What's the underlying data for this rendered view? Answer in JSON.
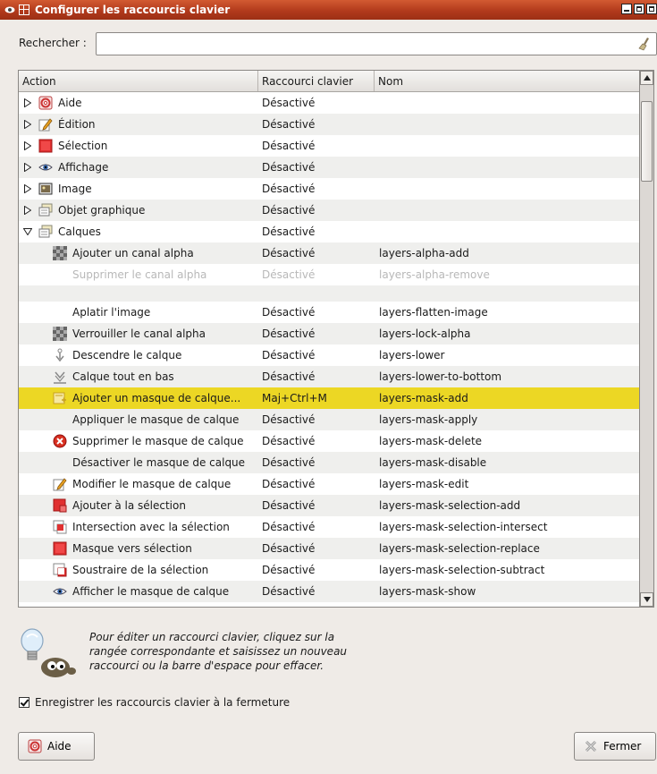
{
  "window": {
    "title": "Configurer les raccourcis clavier"
  },
  "search": {
    "label": "Rechercher :",
    "value": "",
    "placeholder": ""
  },
  "table": {
    "headers": [
      "Action",
      "Raccourci clavier",
      "Nom"
    ],
    "rows": [
      {
        "action": "Aide",
        "shortcut": "Désactivé",
        "name": "",
        "level": 0,
        "expander": "collapsed",
        "icon": "help-icon"
      },
      {
        "action": "Édition",
        "shortcut": "Désactivé",
        "name": "",
        "level": 0,
        "expander": "collapsed",
        "icon": "edit-icon"
      },
      {
        "action": "Sélection",
        "shortcut": "Désactivé",
        "name": "",
        "level": 0,
        "expander": "collapsed",
        "icon": "selection-icon"
      },
      {
        "action": "Affichage",
        "shortcut": "Désactivé",
        "name": "",
        "level": 0,
        "expander": "collapsed",
        "icon": "eye-icon"
      },
      {
        "action": "Image",
        "shortcut": "Désactivé",
        "name": "",
        "level": 0,
        "expander": "collapsed",
        "icon": "image-icon"
      },
      {
        "action": "Objet graphique",
        "shortcut": "Désactivé",
        "name": "",
        "level": 0,
        "expander": "collapsed",
        "icon": "drawable-icon"
      },
      {
        "action": "Calques",
        "shortcut": "Désactivé",
        "name": "",
        "level": 0,
        "expander": "expanded",
        "icon": "layers-icon"
      },
      {
        "action": "Ajouter un canal alpha",
        "shortcut": "Désactivé",
        "name": "layers-alpha-add",
        "level": 1,
        "icon": "alpha-icon"
      },
      {
        "action": "Supprimer le canal alpha",
        "shortcut": "Désactivé",
        "name": "layers-alpha-remove",
        "level": 1,
        "icon": "",
        "faded": true
      },
      {
        "action": "Aplatir l'image",
        "shortcut": "Désactivé",
        "name": "layers-flatten-image",
        "level": 1,
        "icon": ""
      },
      {
        "action": "Verrouiller le canal alpha",
        "shortcut": "Désactivé",
        "name": "layers-lock-alpha",
        "level": 1,
        "icon": "alpha-icon"
      },
      {
        "action": "Descendre le calque",
        "shortcut": "Désactivé",
        "name": "layers-lower",
        "level": 1,
        "icon": "lower-icon"
      },
      {
        "action": "Calque tout en bas",
        "shortcut": "Désactivé",
        "name": "layers-lower-to-bottom",
        "level": 1,
        "icon": "lower-bottom-icon"
      },
      {
        "action": "Ajouter un masque de calque...",
        "shortcut": "Maj+Ctrl+M",
        "name": "layers-mask-add",
        "level": 1,
        "icon": "mask-add-icon",
        "selected": true
      },
      {
        "action": "Appliquer le masque de calque",
        "shortcut": "Désactivé",
        "name": "layers-mask-apply",
        "level": 1,
        "icon": ""
      },
      {
        "action": "Supprimer le masque de calque",
        "shortcut": "Désactivé",
        "name": "layers-mask-delete",
        "level": 1,
        "icon": "delete-icon"
      },
      {
        "action": "Désactiver le masque de calque",
        "shortcut": "Désactivé",
        "name": "layers-mask-disable",
        "level": 1,
        "icon": ""
      },
      {
        "action": "Modifier le masque de calque",
        "shortcut": "Désactivé",
        "name": "layers-mask-edit",
        "level": 1,
        "icon": "edit-icon"
      },
      {
        "action": "Ajouter à la sélection",
        "shortcut": "Désactivé",
        "name": "layers-mask-selection-add",
        "level": 1,
        "icon": "sel-add-icon"
      },
      {
        "action": "Intersection avec la sélection",
        "shortcut": "Désactivé",
        "name": "layers-mask-selection-intersect",
        "level": 1,
        "icon": "sel-intersect-icon"
      },
      {
        "action": "Masque vers sélection",
        "shortcut": "Désactivé",
        "name": "layers-mask-selection-replace",
        "level": 1,
        "icon": "selection-icon"
      },
      {
        "action": "Soustraire de la sélection",
        "shortcut": "Désactivé",
        "name": "layers-mask-selection-subtract",
        "level": 1,
        "icon": "sel-subtract-icon"
      },
      {
        "action": "Afficher le masque de calque",
        "shortcut": "Désactivé",
        "name": "layers-mask-show",
        "level": 1,
        "icon": "eye-icon"
      }
    ]
  },
  "hint": {
    "text": "Pour éditer un raccourci clavier, cliquez sur la rangée correspondante et saisissez un nouveau raccourci ou la barre d'espace pour effacer."
  },
  "save_option": {
    "label": "Enregistrer les raccourcis clavier à la fermeture",
    "checked": true
  },
  "buttons": {
    "help": "Aide",
    "close": "Fermer"
  },
  "colors": {
    "titlebar": "#b23a1c",
    "selection": "#ecd724",
    "background": "#efebe7"
  }
}
